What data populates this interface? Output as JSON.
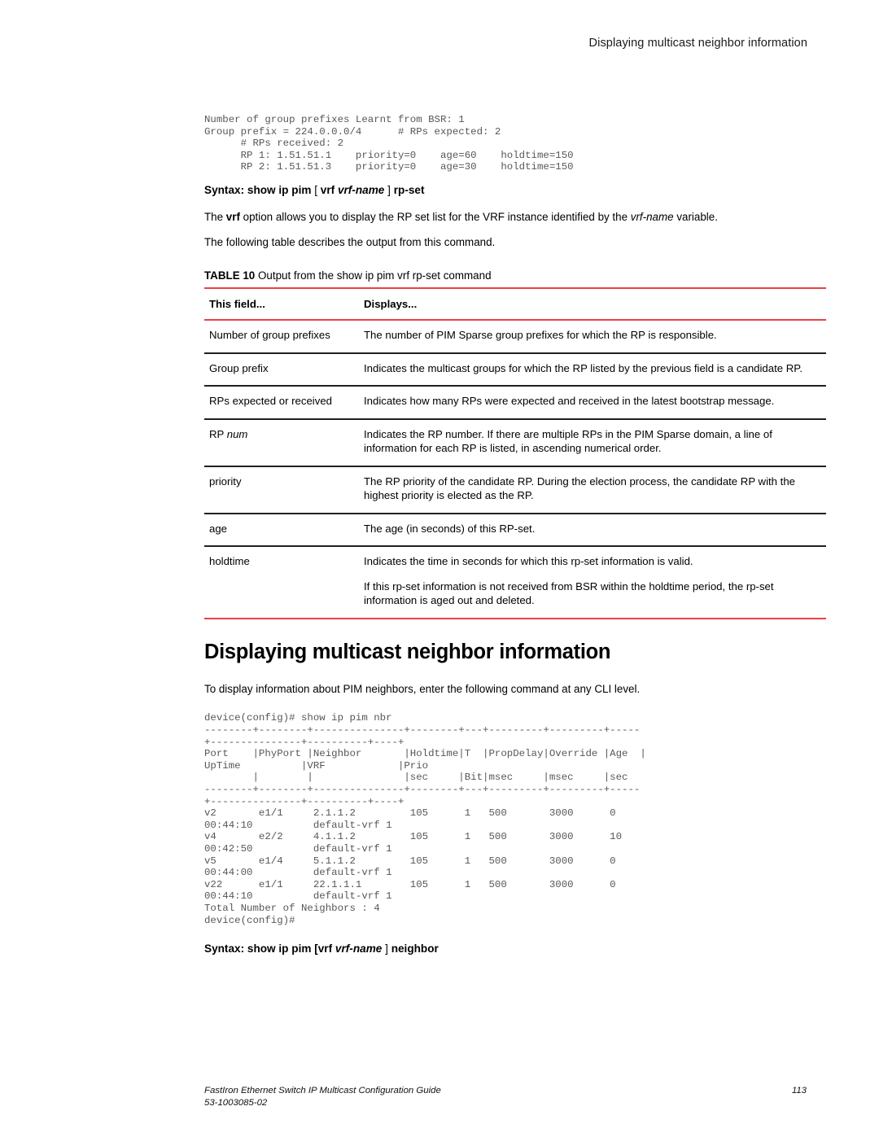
{
  "running_head": "Displaying multicast neighbor information",
  "cli_block_1": "Number of group prefixes Learnt from BSR: 1\nGroup prefix = 224.0.0.0/4      # RPs expected: 2\n      # RPs received: 2\n      RP 1: 1.51.51.1    priority=0    age=60    holdtime=150\n      RP 2: 1.51.51.3    priority=0    age=30    holdtime=150",
  "syntax_1": {
    "label": "Syntax:",
    "command": "show ip pim",
    "open_bracket": "[",
    "vrf_keyword": "vrf",
    "vrf_variable": "vrf-name",
    "close_bracket": "]",
    "tail": "rp-set"
  },
  "paragraph_1": {
    "before": "The ",
    "bold": "vrf",
    "middle": " option allows you to display the RP set list for the VRF instance identified by the ",
    "italic": "vrf-name",
    "after": " variable."
  },
  "paragraph_2": "The following table describes the output from this command.",
  "table": {
    "caption_number": "TABLE 10",
    "caption_text": "Output from the show ip pim vrf rp-set command",
    "headers": [
      "This field...",
      "Displays..."
    ],
    "rows": [
      {
        "field": "Number of group prefixes",
        "field_italic": "",
        "displays": [
          "The number of PIM Sparse group prefixes for which the RP is responsible."
        ]
      },
      {
        "field": "Group prefix",
        "field_italic": "",
        "displays": [
          "Indicates the multicast groups for which the RP listed by the previous field is a candidate RP."
        ]
      },
      {
        "field": "RPs expected or received",
        "field_italic": "",
        "displays": [
          "Indicates how many RPs were expected and received in the latest bootstrap message."
        ]
      },
      {
        "field": "RP ",
        "field_italic": "num",
        "displays": [
          "Indicates the RP number. If there are multiple RPs in the PIM Sparse domain, a line of information for each RP is listed, in ascending numerical order."
        ]
      },
      {
        "field": "priority",
        "field_italic": "",
        "displays": [
          "The RP priority of the candidate RP. During the election process, the candidate RP with the highest priority is elected as the RP."
        ]
      },
      {
        "field": "age",
        "field_italic": "",
        "displays": [
          "The age (in seconds) of this RP-set."
        ]
      },
      {
        "field": "holdtime",
        "field_italic": "",
        "displays": [
          "Indicates the time in seconds for which this rp-set information is valid.",
          "If this rp-set information is not received from BSR within the holdtime period, the rp-set information is aged out and deleted."
        ]
      }
    ]
  },
  "section_heading": "Displaying multicast neighbor information",
  "paragraph_3": "To display information about PIM neighbors, enter the following command at any CLI level.",
  "cli_block_2": "device(config)# show ip pim nbr\n--------+--------+---------------+--------+---+---------+---------+-----\n+---------------+----------+----+\nPort    |PhyPort |Neighbor       |Holdtime|T  |PropDelay|Override |Age  |\nUpTime          |VRF            |Prio\n        |        |               |sec     |Bit|msec     |msec     |sec\n--------+--------+---------------+--------+---+---------+---------+-----\n+---------------+----------+----+\nv2       e1/1     2.1.1.2         105      1   500       3000      0\n00:44:10          default-vrf 1\nv4       e2/2     4.1.1.2         105      1   500       3000      10\n00:42:50          default-vrf 1\nv5       e1/4     5.1.1.2         105      1   500       3000      0\n00:44:00          default-vrf 1\nv22      e1/1     22.1.1.1        105      1   500       3000      0\n00:44:10          default-vrf 1\nTotal Number of Neighbors : 4\ndevice(config)#",
  "syntax_2": {
    "label": "Syntax:",
    "command": "show ip pim",
    "open_bracket": "[",
    "vrf_keyword": "vrf",
    "vrf_variable": "vrf-name",
    "close_bracket": "]",
    "tail": "neighbor"
  },
  "footer": {
    "title": "FastIron Ethernet Switch IP Multicast Configuration Guide",
    "doc_number": "53-1003085-02",
    "page_number": "113"
  },
  "colors": {
    "rule_red": "#ef3e42",
    "rule_black": "#231f20",
    "cli_gray": "#575757"
  }
}
